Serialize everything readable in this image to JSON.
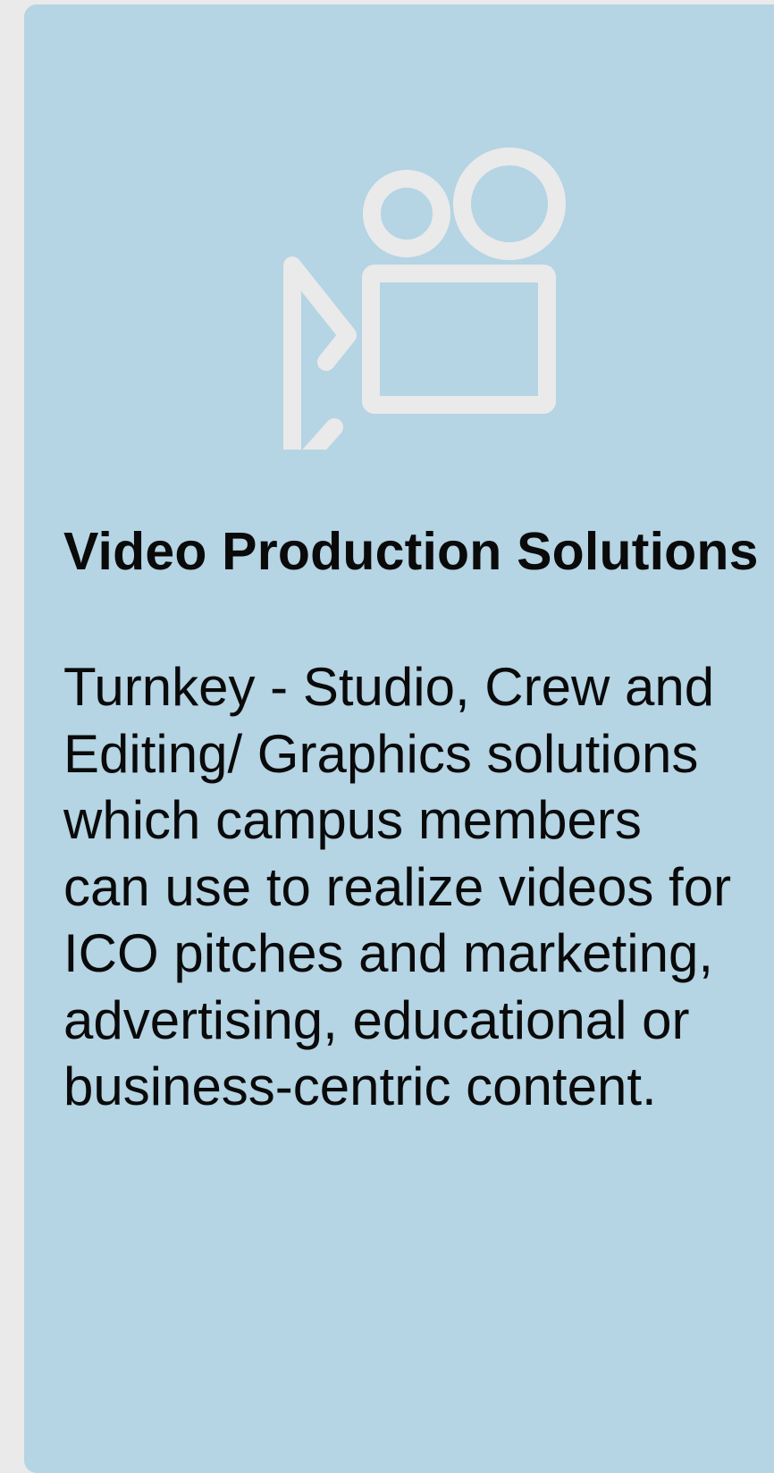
{
  "card": {
    "background": "#b5d4e4",
    "icon": "video-camera-icon",
    "icon_color": "#eaeaea",
    "title": "Video Production Solutions",
    "description": "Turnkey - Studio, Crew and Editing/ Graphics solutions which campus members can use to realize videos for ICO pitches and marketing, advertising, educational or business-centric content."
  }
}
